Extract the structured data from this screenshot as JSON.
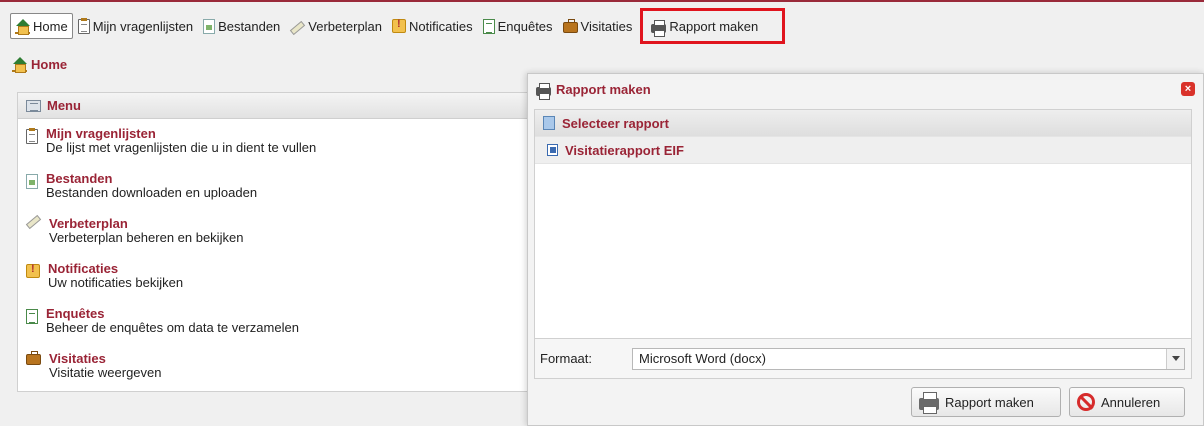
{
  "nav": {
    "items": [
      {
        "label": "Home",
        "icon": "home-icon"
      },
      {
        "label": "Mijn vragenlijsten",
        "icon": "clipboard-icon"
      },
      {
        "label": "Bestanden",
        "icon": "file-icon"
      },
      {
        "label": "Verbeterplan",
        "icon": "pencil-icon"
      },
      {
        "label": "Notificaties",
        "icon": "notification-icon"
      },
      {
        "label": "Enquêtes",
        "icon": "form-icon"
      },
      {
        "label": "Visitaties",
        "icon": "briefcase-icon"
      },
      {
        "label": "Rapport maken",
        "icon": "printer-icon"
      }
    ],
    "active": "Home",
    "highlighted": "Rapport maken"
  },
  "breadcrumb": {
    "label": "Home"
  },
  "menu": {
    "title": "Menu",
    "items": [
      {
        "title": "Mijn vragenlijsten",
        "desc": "De lijst met vragenlijsten die u in dient te vullen"
      },
      {
        "title": "Bestanden",
        "desc": "Bestanden downloaden en uploaden"
      },
      {
        "title": "Verbeterplan",
        "desc": "Verbeterplan beheren en bekijken"
      },
      {
        "title": "Notificaties",
        "desc": "Uw notificaties bekijken"
      },
      {
        "title": "Enquêtes",
        "desc": "Beheer de enquêtes om data te verzamelen"
      },
      {
        "title": "Visitaties",
        "desc": "Visitatie weergeven"
      }
    ]
  },
  "dialog": {
    "title": "Rapport maken",
    "section_title": "Selecteer rapport",
    "reports": [
      "Visitatierapport EIF"
    ],
    "format_label": "Formaat:",
    "format_value": "Microsoft Word (docx)",
    "submit_label": "Rapport maken",
    "cancel_label": "Annuleren"
  },
  "colors": {
    "accent": "#9a2436",
    "highlight_box": "#e0141e"
  }
}
